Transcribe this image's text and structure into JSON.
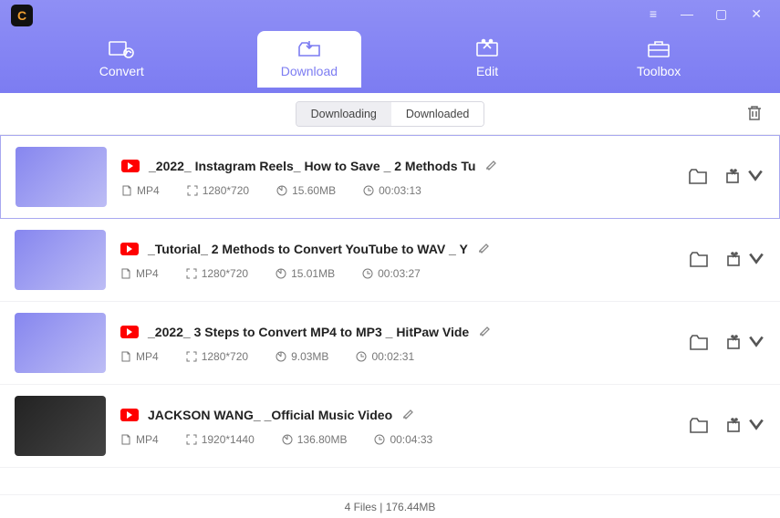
{
  "tabs": {
    "convert": "Convert",
    "download": "Download",
    "edit": "Edit",
    "toolbox": "Toolbox"
  },
  "segments": {
    "downloading": "Downloading",
    "downloaded": "Downloaded"
  },
  "items": [
    {
      "title": "_2022_ Instagram Reels_ How to Save _ 2 Methods Tu",
      "format": "MP4",
      "resolution": "1280*720",
      "size": "15.60MB",
      "duration": "00:03:13",
      "thumbStyle": "light"
    },
    {
      "title": "_Tutorial_ 2 Methods to Convert YouTube to WAV _ Y",
      "format": "MP4",
      "resolution": "1280*720",
      "size": "15.01MB",
      "duration": "00:03:27",
      "thumbStyle": "light"
    },
    {
      "title": "_2022_ 3 Steps to Convert MP4 to MP3 _ HitPaw Vide",
      "format": "MP4",
      "resolution": "1280*720",
      "size": "9.03MB",
      "duration": "00:02:31",
      "thumbStyle": "light"
    },
    {
      "title": "JACKSON WANG_ _Official Music Video",
      "format": "MP4",
      "resolution": "1920*1440",
      "size": "136.80MB",
      "duration": "00:04:33",
      "thumbStyle": "dark"
    }
  ],
  "footer": "4 Files | 176.44MB"
}
